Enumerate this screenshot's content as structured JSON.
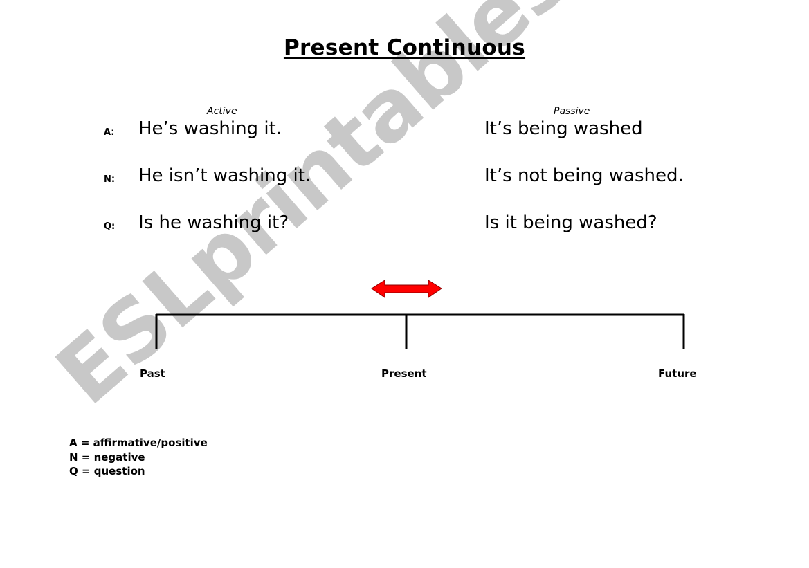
{
  "title": "Present Continuous",
  "columns": {
    "active_label": "Active",
    "passive_label": "Passive"
  },
  "rows": [
    {
      "marker": "A:",
      "active": "He’s washing it.",
      "passive": "It’s being washed"
    },
    {
      "marker": "N:",
      "active": "He isn’t washing it.",
      "passive": "It’s not being washed."
    },
    {
      "marker": "Q:",
      "active": "Is he washing it?",
      "passive": "Is it being washed?"
    }
  ],
  "timeline": {
    "labels": {
      "past": "Past",
      "present": "Present",
      "future": "Future"
    },
    "arrow_icon": "double-headed-arrow",
    "arrow_color": "#ff0000"
  },
  "legend": [
    "A = affirmative/positive",
    "N = negative",
    "Q = question"
  ],
  "watermark": "ESLprintables.com",
  "colors": {
    "text": "#000000",
    "watermark": "#c8c8c8",
    "arrow_fill": "#ff0000"
  }
}
